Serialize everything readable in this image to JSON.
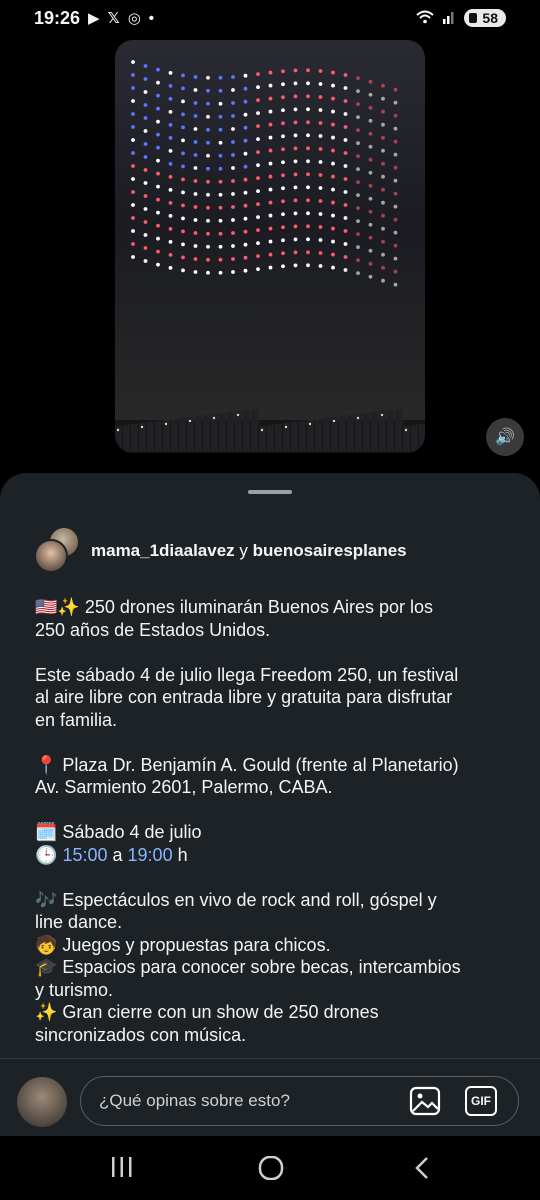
{
  "status": {
    "time": "19:26",
    "battery": "58"
  },
  "icons": {
    "youtube": "youtube-icon",
    "x": "x-icon",
    "instagram": "instagram-icon",
    "wifi": "wifi-icon",
    "signal": "signal-icon",
    "sound": "speaker-icon"
  },
  "post": {
    "author1": "mama_1diaalavez",
    "connector": "y",
    "author2": "buenosairesplanes",
    "caption": {
      "l1": "🇺🇸✨ 250 drones iluminarán Buenos Aires por los",
      "l2": "250 años de Estados Unidos.",
      "l3": "Este sábado 4 de julio llega Freedom 250, un festival",
      "l4": "al aire libre con entrada libre y gratuita para disfrutar",
      "l5": "en familia.",
      "l6": "📍 Plaza Dr. Benjamín A. Gould (frente al Planetario)",
      "l7": "Av. Sarmiento 2601, Palermo, CABA.",
      "l8": "🗓️ Sábado 4 de julio",
      "l9_prefix": "🕒",
      "l9_time1": "15:00",
      "l9_mid": "a",
      "l9_time2": "19:00",
      "l9_suffix": "h",
      "l10": "🎶 Espectáculos en vivo de rock and roll, góspel y",
      "l11": "line dance.",
      "l12": "🧒 Juegos y propuestas para chicos.",
      "l13": "🎓 Espacios para conocer sobre becas, intercambios",
      "l14": "y turismo.",
      "l15": "✨ Gran cierre con un show de 250 drones",
      "l16": "sincronizados con música."
    }
  },
  "comment": {
    "placeholder": "¿Qué opinas sobre esto?",
    "gif_label": "GIF"
  },
  "colors": {
    "sheet_bg": "#1d2226",
    "link": "#8ab4ff"
  }
}
